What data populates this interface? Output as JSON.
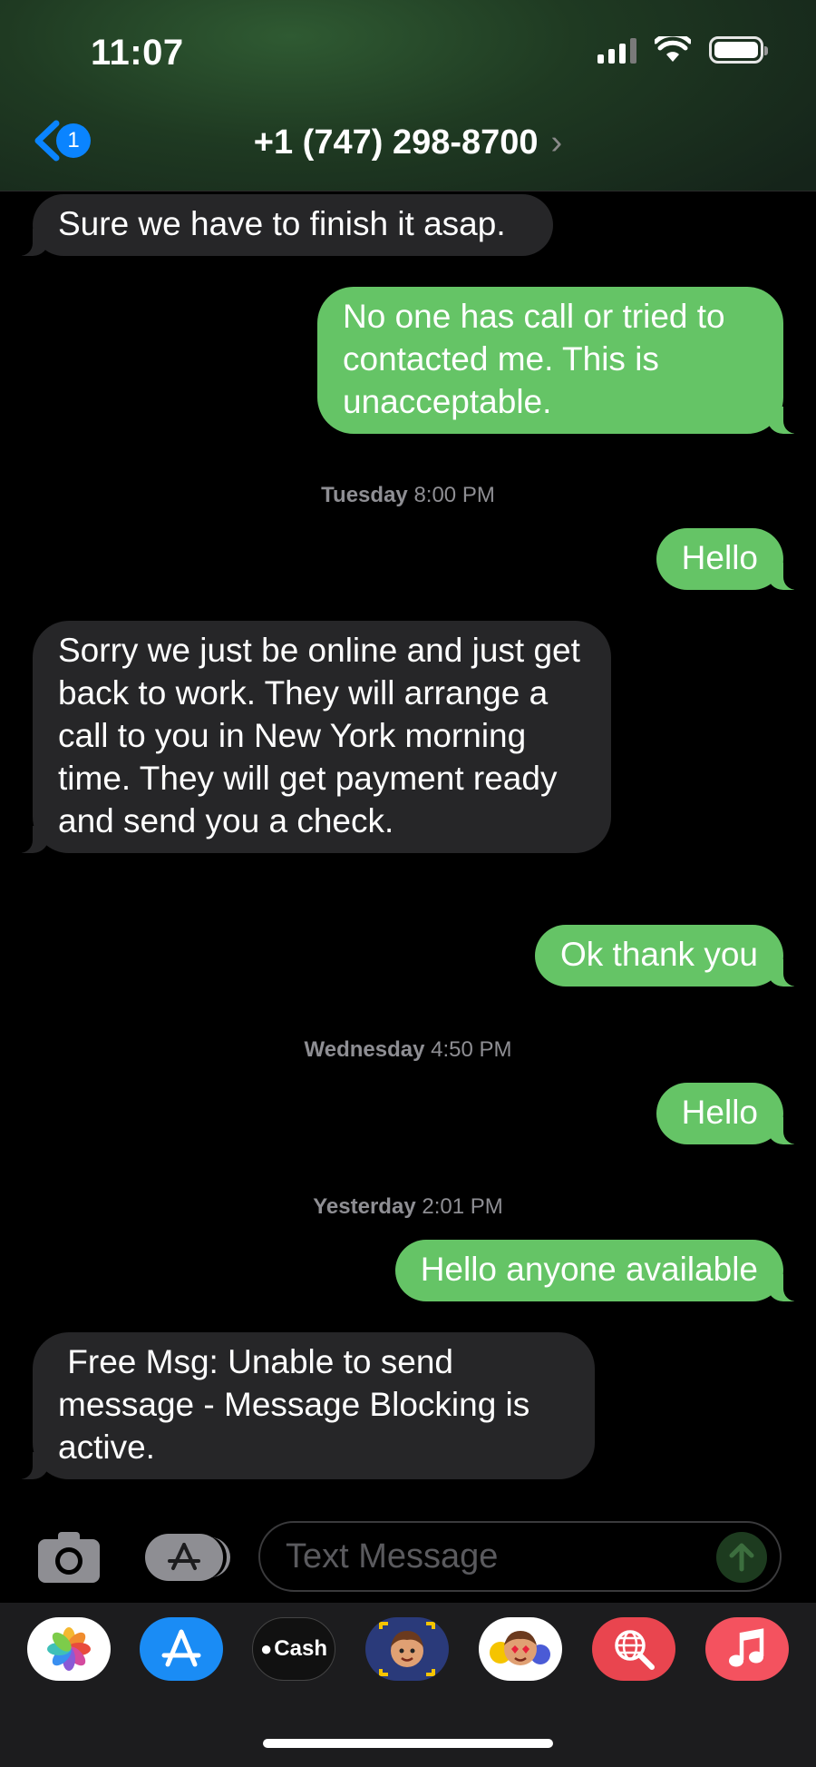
{
  "status_bar": {
    "time": "11:07"
  },
  "header": {
    "back_badge": "1",
    "contact": "+1 (747) 298-8700",
    "chevron": "›"
  },
  "messages": [
    {
      "dir": "in",
      "text": "Sure we have to finish it asap."
    },
    {
      "dir": "out",
      "text": "No one has call or tried to contacted me. This is unacceptable."
    },
    {
      "type": "timestamp",
      "day": "Tuesday",
      "time": "8:00 PM"
    },
    {
      "dir": "out",
      "text": "Hello"
    },
    {
      "dir": "in",
      "text": "Sorry we just be online and just get back to work. They will arrange a call to you in New York morning time. They will get payment ready and send you a check."
    },
    {
      "dir": "out",
      "text": "Ok thank you"
    },
    {
      "type": "timestamp",
      "day": "Wednesday",
      "time": "4:50 PM"
    },
    {
      "dir": "out",
      "text": "Hello"
    },
    {
      "type": "timestamp",
      "day": "Yesterday",
      "time": "2:01 PM"
    },
    {
      "dir": "out",
      "text": "Hello anyone available"
    },
    {
      "dir": "in",
      "text": " Free Msg: Unable to send message - Message Blocking is active."
    }
  ],
  "input": {
    "placeholder": "Text Message"
  },
  "drawer": {
    "apps": [
      "photos-app-icon",
      "app-store-icon",
      "apple-cash-icon",
      "memoji-icon",
      "animoji-stickers-icon",
      "web-search-icon",
      "music-icon"
    ],
    "cash_label": "Cash"
  },
  "colors": {
    "outgoing": "#65c466",
    "incoming": "#262628",
    "accent": "#0a84ff"
  }
}
